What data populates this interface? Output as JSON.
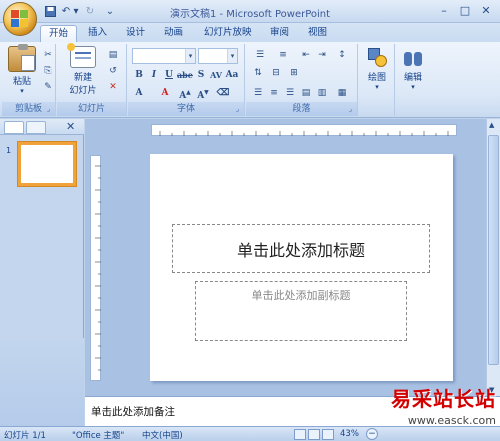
{
  "window": {
    "title": "演示文稿1 - Microsoft PowerPoint"
  },
  "tabs": [
    {
      "label": "开始",
      "active": true
    },
    {
      "label": "插入"
    },
    {
      "label": "设计"
    },
    {
      "label": "动画"
    },
    {
      "label": "幻灯片放映"
    },
    {
      "label": "审阅"
    },
    {
      "label": "视图"
    }
  ],
  "ribbon": {
    "clipboard": {
      "label": "剪贴板",
      "paste": "粘贴"
    },
    "slides": {
      "label": "幻灯片",
      "new_slide_line1": "新建",
      "new_slide_line2": "幻灯片"
    },
    "font": {
      "label": "字体",
      "font_size_value": "",
      "font_name_value": ""
    },
    "paragraph": {
      "label": "段落"
    },
    "drawing": {
      "label": "绘图"
    },
    "editing": {
      "label": "编辑"
    }
  },
  "slide": {
    "title_placeholder": "单击此处添加标题",
    "subtitle_placeholder": "单击此处添加副标题"
  },
  "thumbnail": {
    "number": "1"
  },
  "notes": {
    "placeholder": "单击此处添加备注"
  },
  "status": {
    "slide_info": "幻灯片 1/1",
    "theme": "\"Office 主题\"",
    "language": "中文(中国)",
    "zoom": "43%"
  },
  "watermark": {
    "text": "易采站长站",
    "url": "www.easck.com"
  },
  "colors": {
    "ribbon_bg": "#dce8f7",
    "accent": "#f0a23c",
    "text": "#15428b"
  }
}
